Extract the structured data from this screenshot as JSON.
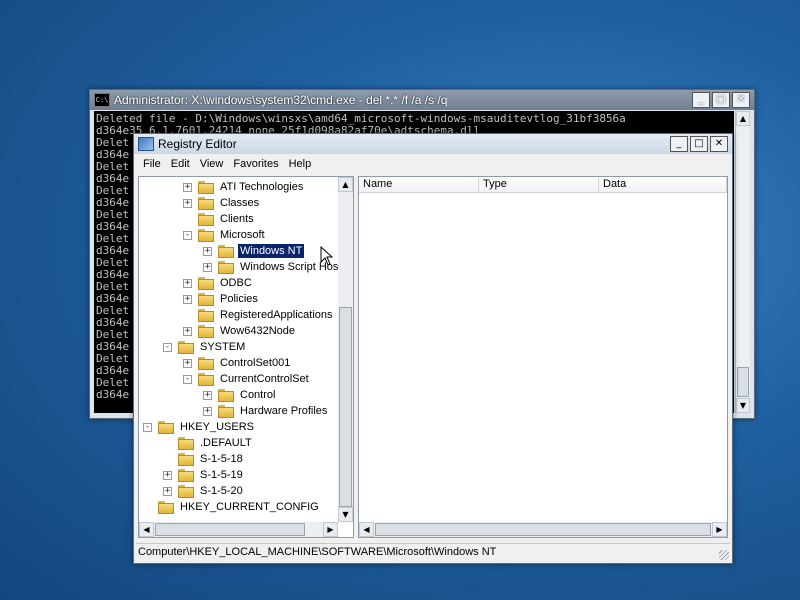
{
  "cmd": {
    "title": "Administrator: X:\\windows\\system32\\cmd.exe - del *.* /f /a /s /q",
    "icon": "cmd-icon",
    "lines": [
      "Deleted file - D:\\Windows\\winsxs\\amd64_microsoft-windows-msauditevtlog_31bf3856a",
      "d364e35_6.1.7601.24214_none_25f1d098a82af70e\\adtschema.dll",
      "Delet",
      "d364e",
      "Delet",
      "d364e",
      "Delet",
      "d364e",
      "Delet",
      "d364e",
      "Delet",
      "d364e",
      "Delet",
      "d364e",
      "Delet",
      "d364e",
      "Delet",
      "d364e",
      "Delet",
      "d364e",
      "Delet",
      "d364e",
      "Delet",
      "d364e"
    ],
    "buttons": {
      "minimize": "_",
      "maximize": "□",
      "close": "✕"
    }
  },
  "regedit": {
    "title": "Registry Editor",
    "menu": [
      "File",
      "Edit",
      "View",
      "Favorites",
      "Help"
    ],
    "tree": [
      {
        "label": "ATI Technologies",
        "expander": "+"
      },
      {
        "label": "Classes",
        "expander": "+"
      },
      {
        "label": "Clients",
        "expander": ""
      },
      {
        "label": "Microsoft",
        "expander": "-"
      },
      {
        "label": "Windows NT",
        "expander": "+",
        "selected": true
      },
      {
        "label": "Windows Script Host",
        "expander": "+"
      },
      {
        "label": "ODBC",
        "expander": "+"
      },
      {
        "label": "Policies",
        "expander": "+"
      },
      {
        "label": "RegisteredApplications",
        "expander": ""
      },
      {
        "label": "Wow6432Node",
        "expander": "+"
      },
      {
        "label": "SYSTEM",
        "expander": "-"
      },
      {
        "label": "ControlSet001",
        "expander": "+"
      },
      {
        "label": "CurrentControlSet",
        "expander": "-"
      },
      {
        "label": "Control",
        "expander": "+"
      },
      {
        "label": "Hardware Profiles",
        "expander": "+"
      },
      {
        "label": "HKEY_USERS",
        "expander": "-"
      },
      {
        "label": ".DEFAULT",
        "expander": ""
      },
      {
        "label": "S-1-5-18",
        "expander": ""
      },
      {
        "label": "S-1-5-19",
        "expander": "+"
      },
      {
        "label": "S-1-5-20",
        "expander": "+"
      },
      {
        "label": "HKEY_CURRENT_CONFIG",
        "expander": ""
      }
    ],
    "columns": [
      "Name",
      "Type",
      "Data"
    ],
    "status": "Computer\\HKEY_LOCAL_MACHINE\\SOFTWARE\\Microsoft\\Windows NT",
    "buttons": {
      "minimize": "_",
      "maximize": "□",
      "close": "✕"
    }
  }
}
